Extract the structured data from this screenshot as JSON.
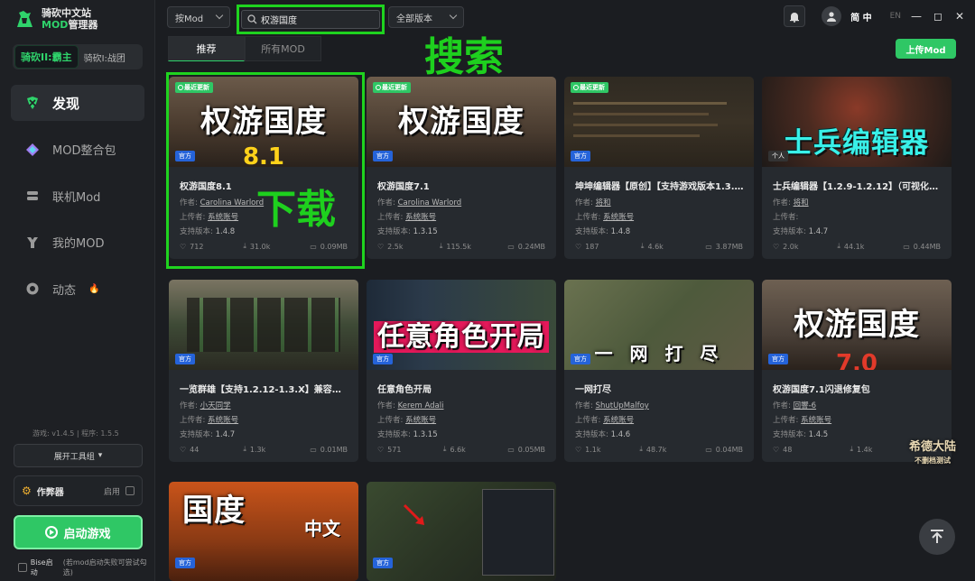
{
  "app": {
    "title_line1": "骑砍中文站",
    "title_mod": "MOD",
    "title_line2": "管理器",
    "game_active": "骑砍II:霸主",
    "game_other": "骑砍I:战团"
  },
  "sidebar": {
    "items": [
      {
        "label": "发现",
        "icon": "discover-icon"
      },
      {
        "label": "MOD整合包",
        "icon": "modpack-icon"
      },
      {
        "label": "联机Mod",
        "icon": "multiplayer-icon"
      },
      {
        "label": "我的MOD",
        "icon": "my-mod-icon"
      },
      {
        "label": "动态",
        "icon": "feed-icon"
      }
    ],
    "version_text": "游戏: v1.4.5 | 程序: 1.5.5",
    "tools_label": "展开工具组",
    "author_label": "作弊器",
    "author_enable": "启用",
    "launch_label": "启动游戏",
    "bise_label": "Bise启动",
    "bise_note": "(若mod启动失败可尝试勾选)"
  },
  "topbar": {
    "sort_label": "按Mod",
    "search_value": "权游国度",
    "version_filter": "全部版本",
    "lang_cn": "简 中",
    "lang_en": "EN"
  },
  "annotations": {
    "search": "搜索",
    "download": "下载"
  },
  "tabs": [
    {
      "label": "推荐"
    },
    {
      "label": "所有MOD"
    }
  ],
  "upload_label": "上传Mod",
  "meta_labels": {
    "author": "作者:",
    "uploader": "上传者:",
    "version": "支持版本:"
  },
  "cards": [
    {
      "title": "权游国度8.1",
      "author": "Carolina Warlord",
      "uploader": "系统账号",
      "version": "1.4.8",
      "likes": "712",
      "downloads": "31.0k",
      "size": "0.09MB",
      "badge": "官方",
      "new": "最近更新",
      "thumb_text": "权游国度",
      "thumb_sub": "8.1"
    },
    {
      "title": "权游国度7.1",
      "author": "Carolina Warlord",
      "uploader": "系统账号",
      "version": "1.3.15",
      "likes": "2.5k",
      "downloads": "115.5k",
      "size": "0.24MB",
      "badge": "官方",
      "new": "最近更新",
      "thumb_text": "权游国度"
    },
    {
      "title": "坤坤编辑器【原创】【支持游戏版本1.3.15-1.4.8】",
      "author": "将和",
      "uploader": "系统账号",
      "version": "1.4.8",
      "likes": "187",
      "downloads": "4.6k",
      "size": "3.87MB",
      "badge": "官方",
      "new": "最近更新"
    },
    {
      "title": "士兵编辑器【1.2.9-1.2.12】（可视化自定义兵种）",
      "author": "将和",
      "uploader": "",
      "version": "1.4.7",
      "likes": "2.0k",
      "downloads": "44.1k",
      "size": "0.44MB",
      "badge": "个人",
      "thumb_text": "士兵编辑器"
    },
    {
      "title": "一览群雄【支持1.2.12-1.3.X】兼容衣谷三国",
      "author": "小天同学",
      "uploader": "系统账号",
      "version": "1.4.7",
      "likes": "44",
      "downloads": "1.3k",
      "size": "0.01MB",
      "badge": "官方"
    },
    {
      "title": "任意角色开局",
      "author": "Kerem Adali",
      "uploader": "系统账号",
      "version": "1.3.15",
      "likes": "571",
      "downloads": "6.6k",
      "size": "0.05MB",
      "badge": "官方",
      "thumb_text": "任意角色开局"
    },
    {
      "title": "一网打尽",
      "author": "ShutUpMalfoy",
      "uploader": "系统账号",
      "version": "1.4.6",
      "likes": "1.1k",
      "downloads": "48.7k",
      "size": "0.04MB",
      "badge": "官方",
      "thumb_text": "一 网 打 尽"
    },
    {
      "title": "权游国度7.1闪退修复包",
      "author": "回響-6",
      "uploader": "系统账号",
      "version": "1.4.5",
      "likes": "48",
      "downloads": "1.4k",
      "size": "",
      "badge": "官方",
      "thumb_text": "权游国度",
      "thumb_sub": "7.0"
    },
    {
      "badge": "官方",
      "thumb_text": "国度",
      "thumb_sub": "中文"
    },
    {
      "badge": "官方"
    }
  ],
  "watermark": {
    "line1": "希德大陆",
    "line2": "不删档测试"
  },
  "colors": {
    "accent": "#2fc765",
    "annotation": "#1fd31f",
    "official_badge": "#2563d9"
  }
}
